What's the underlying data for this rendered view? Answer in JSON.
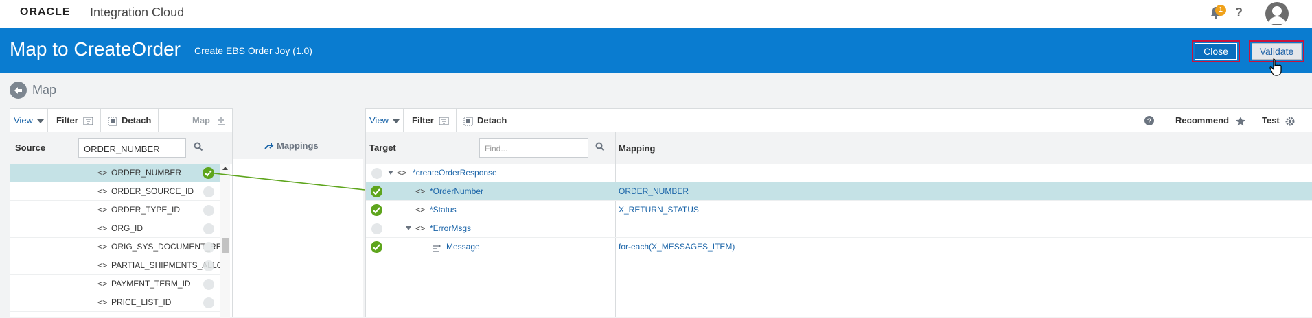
{
  "topbar": {
    "logo": "ORACLE",
    "product": "Integration Cloud",
    "notification_count": "1",
    "help_label": "?"
  },
  "header": {
    "title": "Map to CreateOrder",
    "subtitle": "Create EBS Order Joy (1.0)",
    "close_label": "Close",
    "validate_label": "Validate"
  },
  "map": {
    "title": "Map"
  },
  "source": {
    "toolbar": {
      "view": "View",
      "filter": "Filter",
      "detach": "Detach",
      "map": "Map"
    },
    "header_label": "Source",
    "search_value": "ORDER_NUMBER",
    "items": [
      {
        "label": "ORDER_NUMBER",
        "mapped": true
      },
      {
        "label": "ORDER_SOURCE_ID",
        "mapped": false
      },
      {
        "label": "ORDER_TYPE_ID",
        "mapped": false
      },
      {
        "label": "ORG_ID",
        "mapped": false
      },
      {
        "label": "ORIG_SYS_DOCUMENT_RE",
        "mapped": false
      },
      {
        "label": "PARTIAL_SHIPMENTS_ALLO",
        "mapped": false
      },
      {
        "label": "PAYMENT_TERM_ID",
        "mapped": false
      },
      {
        "label": "PRICE_LIST_ID",
        "mapped": false
      }
    ]
  },
  "mappings": {
    "label": "Mappings"
  },
  "target": {
    "toolbar": {
      "view": "View",
      "filter": "Filter",
      "detach": "Detach",
      "recommend": "Recommend",
      "test": "Test"
    },
    "header_label": "Target",
    "find_placeholder": "Find...",
    "mapping_header": "Mapping",
    "rows": [
      {
        "label": "*createOrderResponse",
        "mapping": ""
      },
      {
        "label": "*OrderNumber",
        "mapping": "ORDER_NUMBER"
      },
      {
        "label": "*Status",
        "mapping": "X_RETURN_STATUS"
      },
      {
        "label": "*ErrorMsgs",
        "mapping": ""
      },
      {
        "label": "Message",
        "mapping": "for-each(X_MESSAGES_ITEM)"
      }
    ]
  },
  "colors": {
    "header_bg": "#0a7cd0",
    "accent_red": "#c8143c",
    "mapped_green": "#5ea51d",
    "selected_row": "#c5e2e6",
    "link_blue": "#1a64a8"
  }
}
